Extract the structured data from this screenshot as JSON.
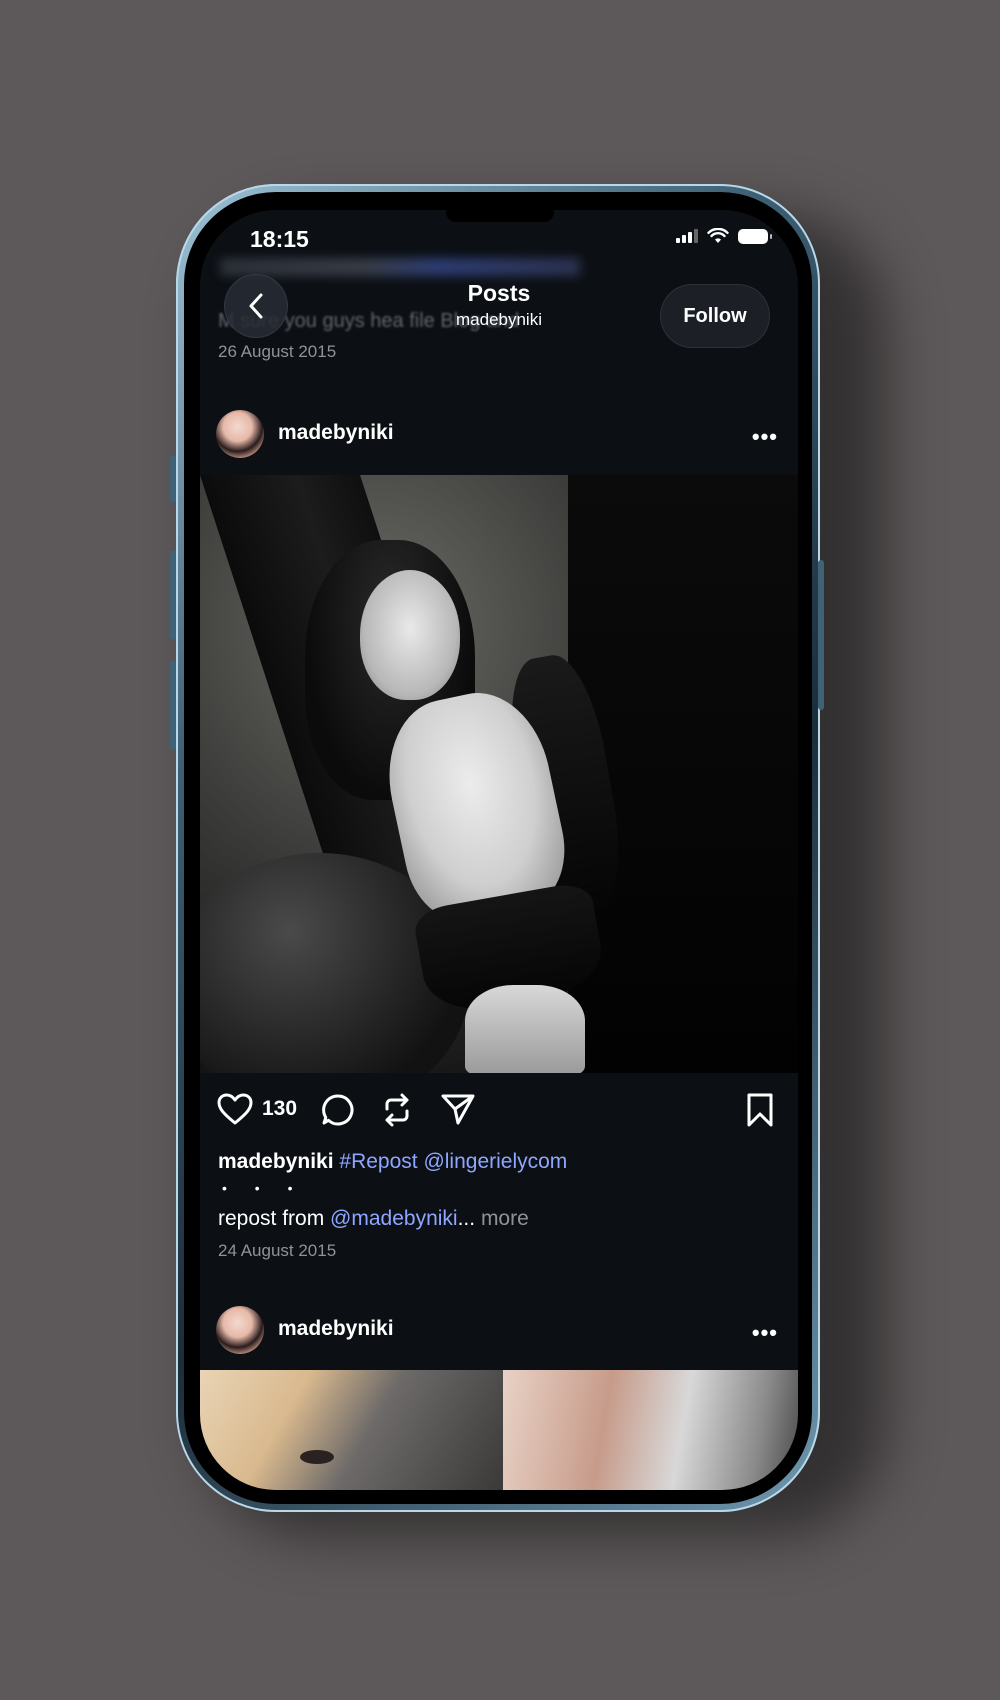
{
  "status_bar": {
    "time": "18:15"
  },
  "header": {
    "title": "Posts",
    "subtitle": "madebyniki",
    "follow_label": "Follow",
    "back_icon": "chevron-left-icon"
  },
  "previous_post": {
    "caption_fragment": "M  sure you guys hea   file Blog and",
    "date": "26 August 2015"
  },
  "post": {
    "username": "madebyniki",
    "more_icon": "more-dots-icon",
    "more_glyph": "•••",
    "image_alt": "black and white photo of woman in lingerie",
    "like_count": "130",
    "caption_user": "madebyniki",
    "caption_tags": "#Repost @lingerielycom",
    "caption_dots": "• • •",
    "caption_line2_prefix": "repost from ",
    "caption_line2_mention": "@madebyniki",
    "caption_line2_ellipsis": "... ",
    "caption_more": "more",
    "date": "24 August 2015"
  },
  "next_post": {
    "username": "madebyniki",
    "more_glyph": "•••"
  },
  "colors": {
    "background": "#5d5859",
    "screen": "#0c1015",
    "link": "#8ea6ff",
    "muted": "#8e939a"
  }
}
